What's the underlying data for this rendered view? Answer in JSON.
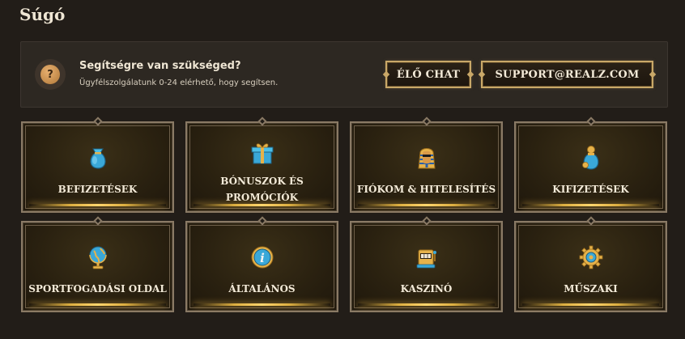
{
  "page": {
    "title": "Súgó"
  },
  "help": {
    "heading": "Segítségre van szükséged?",
    "subtext": "Ügyfélszolgálatunk 0-24 elérhető, hogy segítsen.",
    "icon_glyph": "?",
    "chat_label": "ÉLŐ CHAT",
    "support_label": "SUPPORT@REALZ.COM"
  },
  "categories": [
    {
      "label": "BEFIZETÉSEK",
      "icon": "money-bag-icon"
    },
    {
      "label": "BÓNUSZOK ÉS PROMÓCIÓK",
      "icon": "gift-box-icon"
    },
    {
      "label": "FIÓKOM & HITELESÍTÉS",
      "icon": "pharaoh-icon"
    },
    {
      "label": "KIFIZETÉSEK",
      "icon": "coin-bag-icon"
    },
    {
      "label": "SPORTFOGADÁSI OLDAL",
      "icon": "globe-icon"
    },
    {
      "label": "ÁLTALÁNOS",
      "icon": "info-icon"
    },
    {
      "label": "KASZINÓ",
      "icon": "slot-machine-icon"
    },
    {
      "label": "MŰSZAKI",
      "icon": "gear-icon"
    }
  ],
  "colors": {
    "background": "#221d18",
    "panel": "#2d2822",
    "gold": "#c9a868",
    "glow": "#ffd66e",
    "icon_blue": "#3aa8d8"
  }
}
